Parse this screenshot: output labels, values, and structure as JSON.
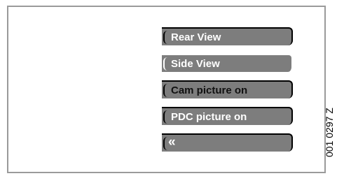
{
  "menu": {
    "items": [
      {
        "label": "Rear View"
      },
      {
        "label": "Side View"
      },
      {
        "label": "Cam picture on"
      },
      {
        "label": "PDC picture on"
      },
      {
        "label": "«"
      }
    ]
  },
  "figure_code": "001 0297 Z"
}
